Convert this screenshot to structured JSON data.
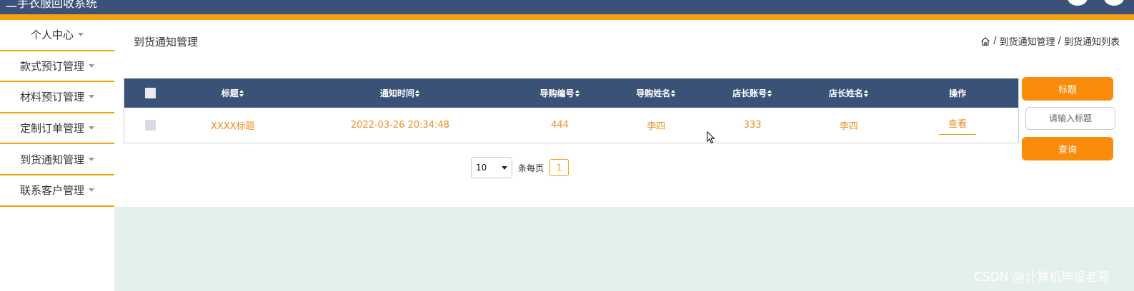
{
  "header": {
    "app_title": "二手衣服回收系统"
  },
  "sidebar": {
    "items": [
      {
        "label": "个人中心"
      },
      {
        "label": "款式预订管理"
      },
      {
        "label": "材料预订管理"
      },
      {
        "label": "定制订单管理"
      },
      {
        "label": "到货通知管理"
      },
      {
        "label": "联系客户管理"
      }
    ]
  },
  "main": {
    "page_title": "到货通知管理",
    "breadcrumb": {
      "sep": "/",
      "item1": "到货通知管理",
      "item2": "到货通知列表"
    },
    "table": {
      "columns": [
        "标题",
        "通知时间",
        "导购编号",
        "导购姓名",
        "店长账号",
        "店长姓名",
        "操作"
      ],
      "rows": [
        {
          "title": "XXXX标题",
          "time": "2022-03-26 20:34:48",
          "guide_no": "444",
          "guide_name": "李四",
          "manager_account": "333",
          "manager_name": "李四",
          "action": "查看"
        }
      ]
    },
    "pager": {
      "page_size": "10",
      "per_page_label": "条每页",
      "current_page": "1"
    }
  },
  "search": {
    "field_label": "标题",
    "placeholder": "请输入标题",
    "query_button": "查询"
  },
  "watermark": "CSDN @计算机毕设老哥",
  "colors": {
    "header": "#3b5278",
    "accent": "#f5a00f",
    "button": "#f98c0a",
    "link": "#f08c1e",
    "content_bg": "#e3f0ec"
  }
}
